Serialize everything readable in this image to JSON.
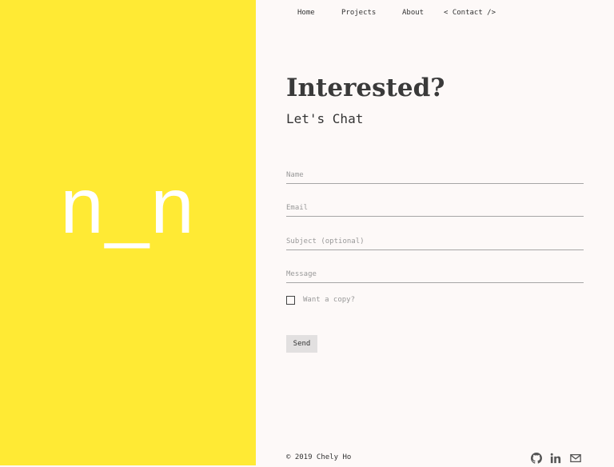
{
  "logo": {
    "text": "n_n"
  },
  "nav": {
    "items": [
      {
        "label": "Home"
      },
      {
        "label": "Projects"
      },
      {
        "label": "About"
      },
      {
        "label": "< Contact />"
      }
    ]
  },
  "heading": {
    "title": "Interested?",
    "subtitle": "Let's Chat"
  },
  "form": {
    "name_placeholder": "Name",
    "email_placeholder": "Email",
    "subject_placeholder": "Subject (optional)",
    "message_placeholder": "Message",
    "copy_label": "Want a copy?",
    "send_label": "Send"
  },
  "footer": {
    "copyright": "© 2019 Chely Ho",
    "social": [
      {
        "icon": "github-icon"
      },
      {
        "icon": "linkedin-icon"
      },
      {
        "icon": "mail-icon"
      }
    ]
  },
  "colors": {
    "accent": "#ffea34",
    "background": "#fdf9f8",
    "text": "#333333"
  }
}
